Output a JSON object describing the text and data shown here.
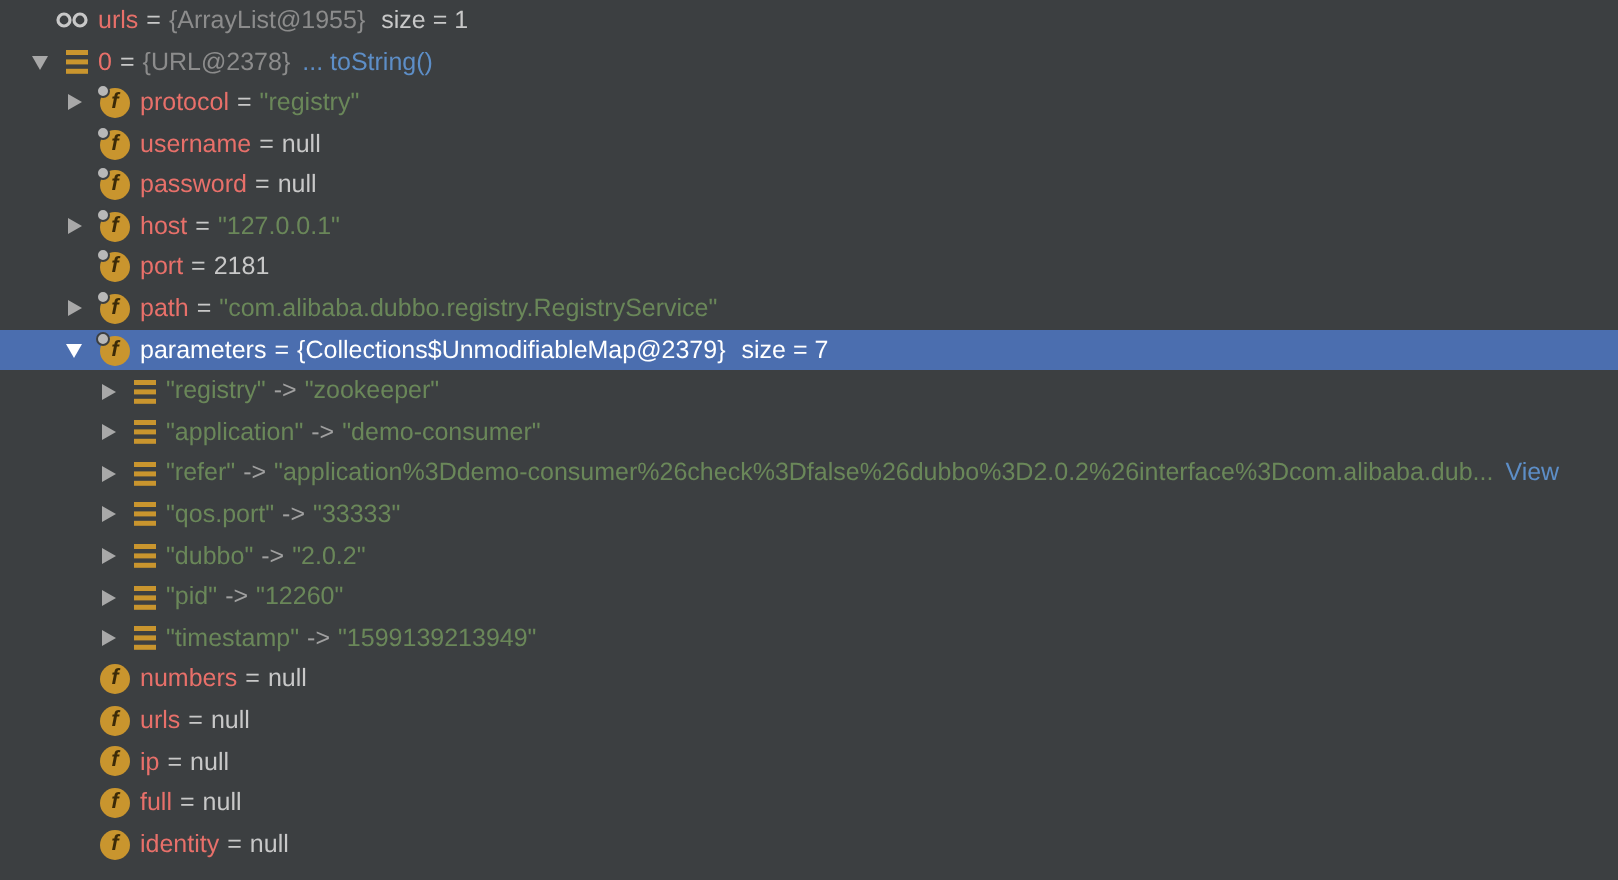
{
  "tree": [
    {
      "kind": "watch",
      "name": "urls",
      "separator": "=",
      "value": "{ArrayList@1955}",
      "extra": "size = 1",
      "selected": false,
      "children": [
        {
          "kind": "item",
          "name": "0",
          "separator": "=",
          "value": "{URL@2378}",
          "link": "... toString()",
          "expanded": true,
          "selected": false,
          "children": [
            {
              "kind": "field",
              "icon": "f",
              "final": true,
              "name": "protocol",
              "separator": "=",
              "value": "\"registry\"",
              "color": "#6a8759",
              "expanded": false,
              "selected": false
            },
            {
              "kind": "field",
              "icon": "f",
              "final": true,
              "name": "username",
              "separator": "=",
              "value": "null",
              "color": "#c8c8c8",
              "selected": false
            },
            {
              "kind": "field",
              "icon": "f",
              "final": true,
              "name": "password",
              "separator": "=",
              "value": "null",
              "color": "#c8c8c8",
              "selected": false
            },
            {
              "kind": "field",
              "icon": "f",
              "final": true,
              "name": "host",
              "separator": "=",
              "value": "\"127.0.0.1\"",
              "color": "#6a8759",
              "expanded": false,
              "selected": false
            },
            {
              "kind": "field",
              "icon": "f",
              "final": true,
              "name": "port",
              "separator": "=",
              "value": "2181",
              "color": "#c8c8c8",
              "selected": false
            },
            {
              "kind": "field",
              "icon": "f",
              "final": true,
              "name": "path",
              "separator": "=",
              "value": "\"com.alibaba.dubbo.registry.RegistryService\"",
              "color": "#6a8759",
              "expanded": false,
              "selected": false
            },
            {
              "kind": "field",
              "icon": "f",
              "final": true,
              "name": "parameters",
              "separator": "=",
              "value": "{Collections$UnmodifiableMap@2379}",
              "extra": "size = 7",
              "expanded": true,
              "selected": true,
              "children": [
                {
                  "kind": "entry",
                  "key": "\"registry\"",
                  "separator": "->",
                  "value": "\"zookeeper\"",
                  "expanded": false,
                  "selected": false
                },
                {
                  "kind": "entry",
                  "key": "\"application\"",
                  "separator": "->",
                  "value": "\"demo-consumer\"",
                  "expanded": false,
                  "selected": false
                },
                {
                  "kind": "entry",
                  "key": "\"refer\"",
                  "separator": "->",
                  "value": "\"application%3Ddemo-consumer%26check%3Dfalse%26dubbo%3D2.0.2%26interface%3Dcom.alibaba.dub...",
                  "link": "View",
                  "expanded": false,
                  "selected": false
                },
                {
                  "kind": "entry",
                  "key": "\"qos.port\"",
                  "separator": "->",
                  "value": "\"33333\"",
                  "expanded": false,
                  "selected": false
                },
                {
                  "kind": "entry",
                  "key": "\"dubbo\"",
                  "separator": "->",
                  "value": "\"2.0.2\"",
                  "expanded": false,
                  "selected": false
                },
                {
                  "kind": "entry",
                  "key": "\"pid\"",
                  "separator": "->",
                  "value": "\"12260\"",
                  "expanded": false,
                  "selected": false
                },
                {
                  "kind": "entry",
                  "key": "\"timestamp\"",
                  "separator": "->",
                  "value": "\"1599139213949\"",
                  "expanded": false,
                  "selected": false
                }
              ]
            },
            {
              "kind": "field",
              "icon": "f",
              "final": false,
              "name": "numbers",
              "separator": "=",
              "value": "null",
              "color": "#c8c8c8",
              "selected": false
            },
            {
              "kind": "field",
              "icon": "f",
              "final": false,
              "name": "urls",
              "separator": "=",
              "value": "null",
              "color": "#c8c8c8",
              "selected": false
            },
            {
              "kind": "field",
              "icon": "f",
              "final": false,
              "name": "ip",
              "separator": "=",
              "value": "null",
              "color": "#c8c8c8",
              "selected": false
            },
            {
              "kind": "field",
              "icon": "f",
              "final": false,
              "name": "full",
              "separator": "=",
              "value": "null",
              "color": "#c8c8c8",
              "selected": false
            },
            {
              "kind": "field",
              "icon": "f",
              "final": false,
              "name": "identity",
              "separator": "=",
              "value": "null",
              "color": "#c8c8c8",
              "selected": false
            }
          ]
        }
      ]
    }
  ]
}
